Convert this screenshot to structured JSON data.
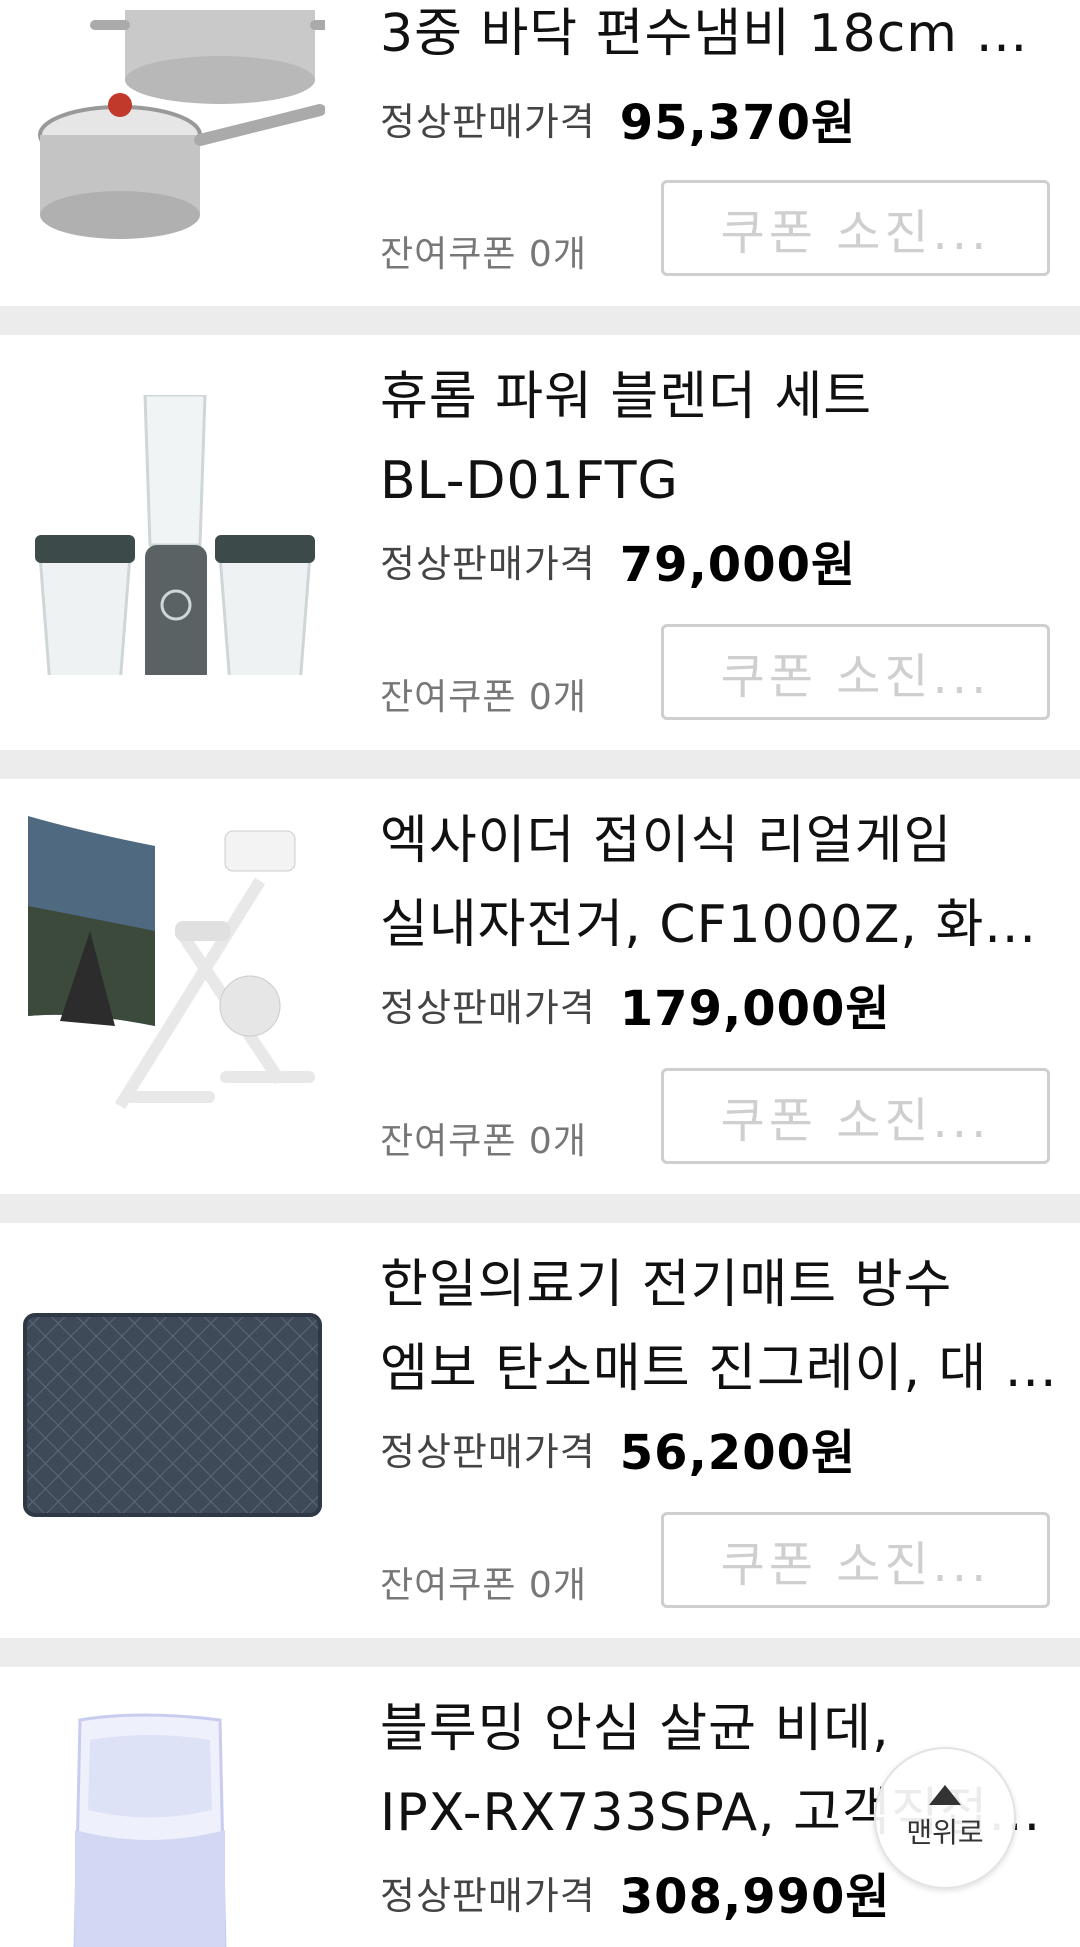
{
  "products": [
    {
      "name_lines": [
        "3중 바닥 편수냄비 18cm + ..."
      ],
      "price_label": "정상판매가격",
      "price": "95,370원",
      "coupon_left": "잔여쿠폰 0개",
      "coupon_button": "쿠폰 소진...",
      "image_icon": "stainless-pot-set-icon"
    },
    {
      "name_lines": [
        "휴롬 파워 블렌더 세트",
        "BL-D01FTG"
      ],
      "price_label": "정상판매가격",
      "price": "79,000원",
      "coupon_left": "잔여쿠폰 0개",
      "coupon_button": "쿠폰 소진...",
      "image_icon": "blender-set-icon"
    },
    {
      "name_lines": [
        "엑사이더 접이식 리얼게임",
        "실내자전거, CF1000Z, 화..."
      ],
      "price_label": "정상판매가격",
      "price": "179,000원",
      "coupon_left": "잔여쿠폰 0개",
      "coupon_button": "쿠폰 소진...",
      "image_icon": "exercise-bike-icon"
    },
    {
      "name_lines": [
        "한일의료기 전기매트 방수",
        "엠보 탄소매트 진그레이, 대 ..."
      ],
      "price_label": "정상판매가격",
      "price": "56,200원",
      "coupon_left": "잔여쿠폰 0개",
      "coupon_button": "쿠폰 소진...",
      "image_icon": "electric-mat-icon"
    },
    {
      "name_lines": [
        "블루밍 안심 살균 비데,",
        "IPX-RX733SPA, 고객직접..."
      ],
      "price_label": "정상판매가격",
      "price": "308,990원",
      "image_icon": "bidet-icon"
    }
  ],
  "scroll_to_top": {
    "label": "맨위로",
    "icon": "arrow-up-icon"
  },
  "colors": {
    "separator": "#ececec",
    "coupon_disabled": "#cfcfcf"
  }
}
